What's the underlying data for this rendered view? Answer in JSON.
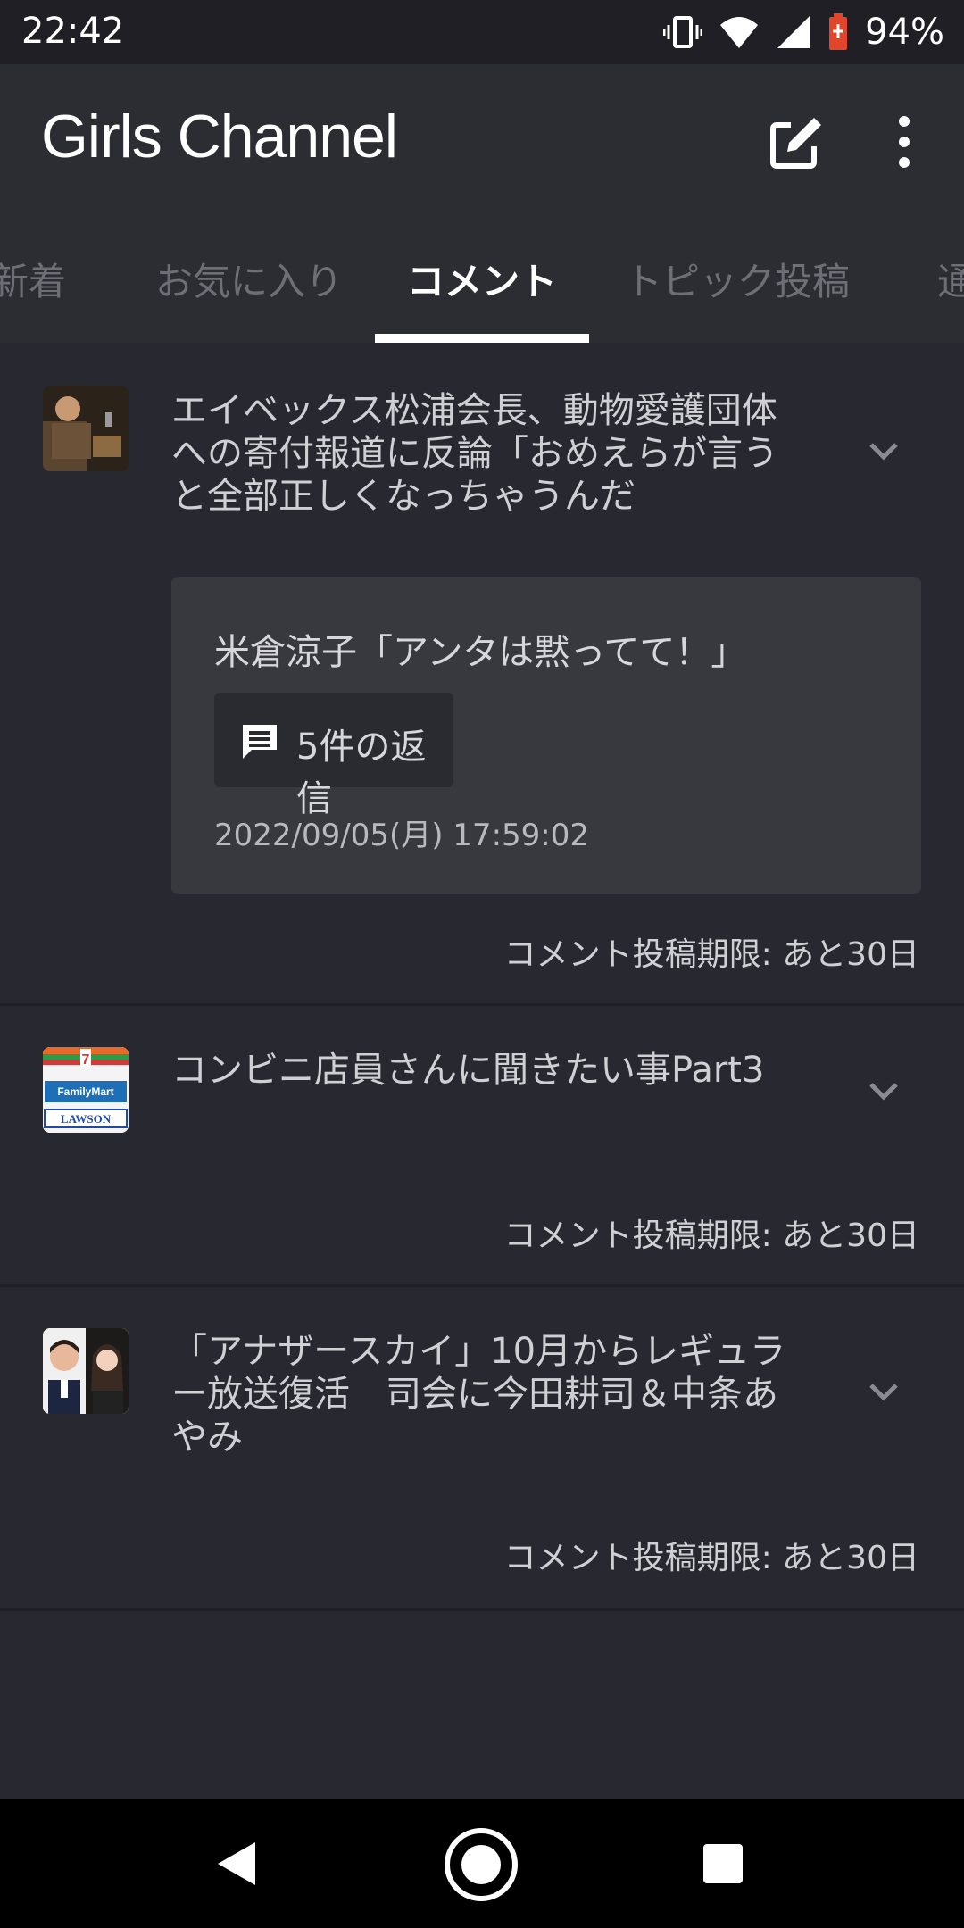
{
  "status_bar": {
    "time": "22:42",
    "battery": "94%"
  },
  "app_bar": {
    "title": "Girls Channel",
    "icons": [
      "edit-icon",
      "more-vert-icon"
    ]
  },
  "tabs": [
    {
      "label": "新着",
      "active": false
    },
    {
      "label": "お気に入り",
      "active": false
    },
    {
      "label": "コメント",
      "active": true
    },
    {
      "label": "トピック投稿",
      "active": false
    },
    {
      "label": "通",
      "active": false
    }
  ],
  "topics": [
    {
      "title": "エイベックス松浦会長、動物愛護団体への寄付報道に反論「おめえらが言うと全部正しくなっちゃうんだ",
      "comment": {
        "text": "米倉涼子「アンタは黙ってて！」",
        "replies": "5件の返信",
        "date": "2022/09/05(月) 17:59:02"
      },
      "deadline": "コメント投稿期限: あと30日"
    },
    {
      "title": "コンビニ店員さんに聞きたい事Part3",
      "thumbnail_text": {
        "brand1": "FamilyMart",
        "brand2": "LAWSON"
      },
      "deadline": "コメント投稿期限: あと30日"
    },
    {
      "title": "「アナザースカイ」10月からレギュラー放送復活　司会に今田耕司＆中条あやみ",
      "deadline": "コメント投稿期限: あと30日"
    }
  ],
  "colors": {
    "background": "#282830",
    "app_bar": "#2c2c33",
    "card": "#38383f",
    "accent_battery": "#e2452a"
  }
}
